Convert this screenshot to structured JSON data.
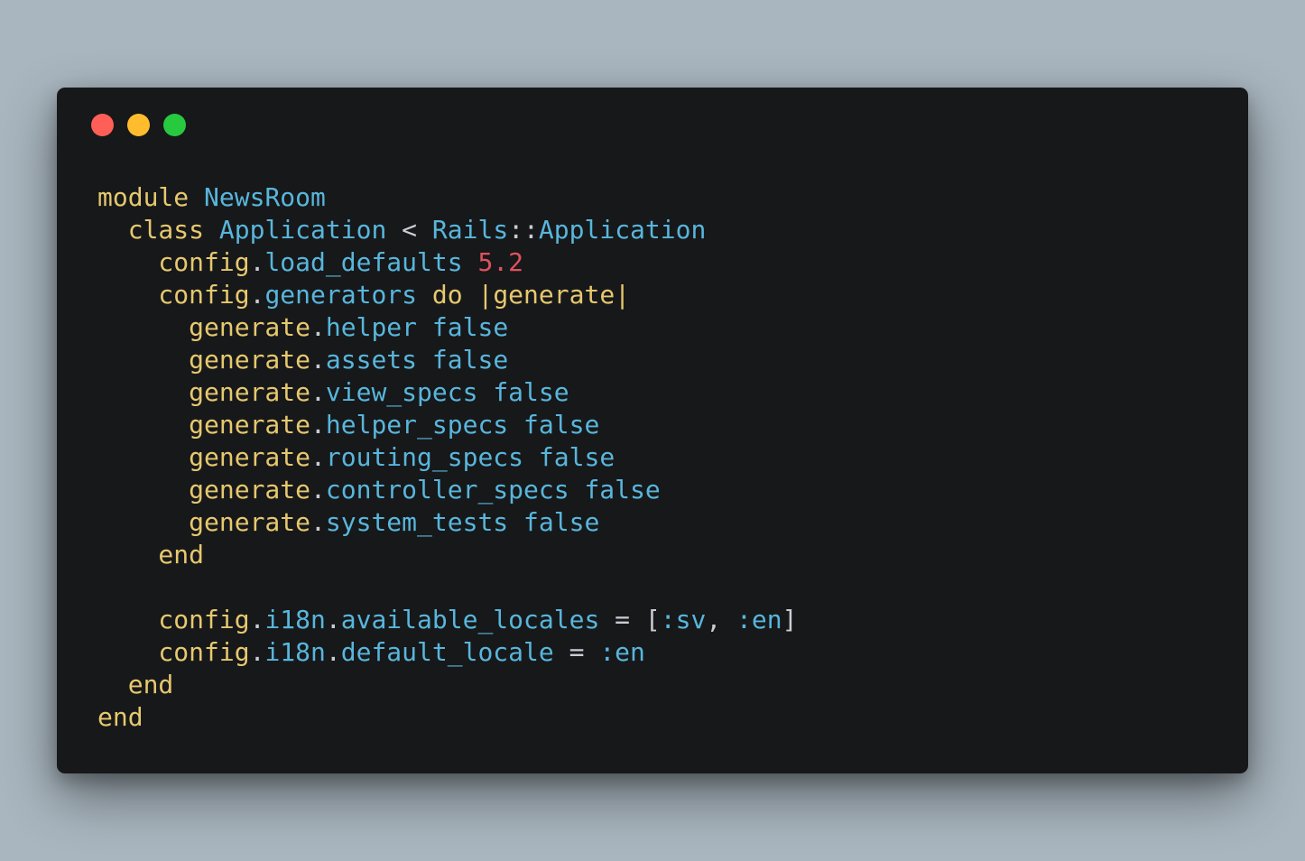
{
  "theme": {
    "background": "#a9b6bf",
    "window_background": "#17181a",
    "close_color": "#ff5f56",
    "minimize_color": "#ffbd2e",
    "maximize_color": "#27c93f",
    "token_colors": {
      "keyword": "#e6c86e",
      "constant": "#58b6dc",
      "method": "#58b6dc",
      "variable": "#e6c86e",
      "number": "#e0525e",
      "operator": "#c8cdd3",
      "symbol": "#58b6dc",
      "plain": "#c8cdd3"
    }
  },
  "code": {
    "language": "ruby",
    "lines": [
      [
        {
          "t": "module",
          "k": "keyword"
        },
        {
          "t": " ",
          "k": "plain"
        },
        {
          "t": "NewsRoom",
          "k": "constant"
        }
      ],
      [
        {
          "t": "  class",
          "k": "keyword"
        },
        {
          "t": " ",
          "k": "plain"
        },
        {
          "t": "Application",
          "k": "constant"
        },
        {
          "t": " < ",
          "k": "operator"
        },
        {
          "t": "Rails",
          "k": "constant"
        },
        {
          "t": "::",
          "k": "operator"
        },
        {
          "t": "Application",
          "k": "constant"
        }
      ],
      [
        {
          "t": "    config",
          "k": "variable"
        },
        {
          "t": ".",
          "k": "operator"
        },
        {
          "t": "load_defaults",
          "k": "method"
        },
        {
          "t": " ",
          "k": "plain"
        },
        {
          "t": "5.2",
          "k": "number"
        }
      ],
      [
        {
          "t": "    config",
          "k": "variable"
        },
        {
          "t": ".",
          "k": "operator"
        },
        {
          "t": "generators",
          "k": "method"
        },
        {
          "t": " ",
          "k": "plain"
        },
        {
          "t": "do",
          "k": "keyword"
        },
        {
          "t": " ",
          "k": "plain"
        },
        {
          "t": "|",
          "k": "keyword"
        },
        {
          "t": "generate",
          "k": "variable"
        },
        {
          "t": "|",
          "k": "keyword"
        }
      ],
      [
        {
          "t": "      generate",
          "k": "variable"
        },
        {
          "t": ".",
          "k": "operator"
        },
        {
          "t": "helper",
          "k": "method"
        },
        {
          "t": " ",
          "k": "plain"
        },
        {
          "t": "false",
          "k": "constant"
        }
      ],
      [
        {
          "t": "      generate",
          "k": "variable"
        },
        {
          "t": ".",
          "k": "operator"
        },
        {
          "t": "assets",
          "k": "method"
        },
        {
          "t": " ",
          "k": "plain"
        },
        {
          "t": "false",
          "k": "constant"
        }
      ],
      [
        {
          "t": "      generate",
          "k": "variable"
        },
        {
          "t": ".",
          "k": "operator"
        },
        {
          "t": "view_specs",
          "k": "method"
        },
        {
          "t": " ",
          "k": "plain"
        },
        {
          "t": "false",
          "k": "constant"
        }
      ],
      [
        {
          "t": "      generate",
          "k": "variable"
        },
        {
          "t": ".",
          "k": "operator"
        },
        {
          "t": "helper_specs",
          "k": "method"
        },
        {
          "t": " ",
          "k": "plain"
        },
        {
          "t": "false",
          "k": "constant"
        }
      ],
      [
        {
          "t": "      generate",
          "k": "variable"
        },
        {
          "t": ".",
          "k": "operator"
        },
        {
          "t": "routing_specs",
          "k": "method"
        },
        {
          "t": " ",
          "k": "plain"
        },
        {
          "t": "false",
          "k": "constant"
        }
      ],
      [
        {
          "t": "      generate",
          "k": "variable"
        },
        {
          "t": ".",
          "k": "operator"
        },
        {
          "t": "controller_specs",
          "k": "method"
        },
        {
          "t": " ",
          "k": "plain"
        },
        {
          "t": "false",
          "k": "constant"
        }
      ],
      [
        {
          "t": "      generate",
          "k": "variable"
        },
        {
          "t": ".",
          "k": "operator"
        },
        {
          "t": "system_tests",
          "k": "method"
        },
        {
          "t": " ",
          "k": "plain"
        },
        {
          "t": "false",
          "k": "constant"
        }
      ],
      [
        {
          "t": "    end",
          "k": "keyword"
        }
      ],
      [],
      [
        {
          "t": "    config",
          "k": "variable"
        },
        {
          "t": ".",
          "k": "operator"
        },
        {
          "t": "i18n",
          "k": "method"
        },
        {
          "t": ".",
          "k": "operator"
        },
        {
          "t": "available_locales",
          "k": "method"
        },
        {
          "t": " = [",
          "k": "operator"
        },
        {
          "t": ":sv",
          "k": "symbol"
        },
        {
          "t": ", ",
          "k": "operator"
        },
        {
          "t": ":en",
          "k": "symbol"
        },
        {
          "t": "]",
          "k": "operator"
        }
      ],
      [
        {
          "t": "    config",
          "k": "variable"
        },
        {
          "t": ".",
          "k": "operator"
        },
        {
          "t": "i18n",
          "k": "method"
        },
        {
          "t": ".",
          "k": "operator"
        },
        {
          "t": "default_locale",
          "k": "method"
        },
        {
          "t": " = ",
          "k": "operator"
        },
        {
          "t": ":en",
          "k": "symbol"
        }
      ],
      [
        {
          "t": "  end",
          "k": "keyword"
        }
      ],
      [
        {
          "t": "end",
          "k": "keyword"
        }
      ]
    ]
  }
}
